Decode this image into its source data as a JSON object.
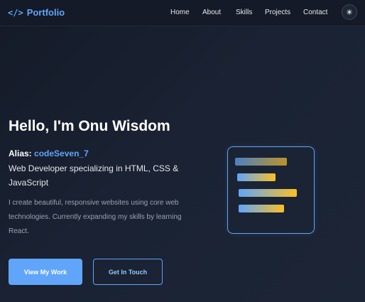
{
  "nav": {
    "brand_icon": "</>",
    "brand": "Portfolio",
    "links": [
      "Home",
      "About",
      "Skills",
      "Projects",
      "Contact"
    ],
    "theme_toggle_icon": "sun-icon"
  },
  "hero": {
    "title": "Hello, I'm Onu Wisdom",
    "alias_label": "Alias:",
    "alias_value": "codeSeven_7",
    "role": "Web Developer specializing in HTML, CSS & JavaScript",
    "description": "I create beautiful, responsive websites using core web technologies. Currently expanding my skills by learning React.",
    "primary_button": "View My Work",
    "secondary_button": "Get In Touch"
  },
  "illustration": {
    "icon": "code-lines-illustration",
    "accent_start": "#60a5fa",
    "accent_end": "#fbbf24"
  },
  "colors": {
    "accent": "#60a5fa",
    "background": "#1a2233",
    "text_muted": "#9ca3af"
  }
}
